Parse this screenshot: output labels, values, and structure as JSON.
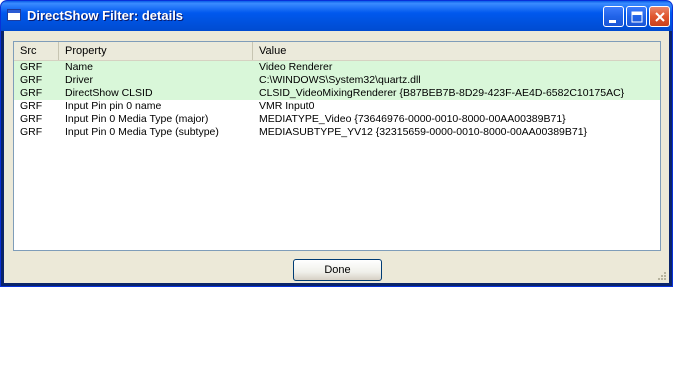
{
  "window": {
    "title": "DirectShow Filter: details"
  },
  "titlebar_buttons": {
    "minimize_icon": "minimize-icon",
    "maximize_icon": "maximize-icon",
    "close_icon": "close-icon"
  },
  "list": {
    "columns": [
      "Src",
      "Property",
      "Value"
    ],
    "rows": [
      {
        "src": "GRF",
        "property": "Name",
        "value": "Video Renderer",
        "highlight": true
      },
      {
        "src": "GRF",
        "property": "Driver",
        "value": "C:\\WINDOWS\\System32\\quartz.dll",
        "highlight": true
      },
      {
        "src": "GRF",
        "property": "DirectShow CLSID",
        "value": "CLSID_VideoMixingRenderer {B87BEB7B-8D29-423F-AE4D-6582C10175AC}",
        "highlight": true
      },
      {
        "src": "GRF",
        "property": "Input Pin pin 0 name",
        "value": "VMR Input0",
        "highlight": false
      },
      {
        "src": "GRF",
        "property": "Input Pin 0 Media Type (major)",
        "value": "MEDIATYPE_Video {73646976-0000-0010-8000-00AA00389B71}",
        "highlight": false
      },
      {
        "src": "GRF",
        "property": "Input Pin 0 Media Type (subtype)",
        "value": "MEDIASUBTYPE_YV12 {32315659-0000-0010-8000-00AA00389B71}",
        "highlight": false
      }
    ]
  },
  "buttons": {
    "done": "Done"
  },
  "colors": {
    "highlight_row": "#d9f7d9",
    "titlebar": "#0054e3",
    "dialog_bg": "#ece9d8"
  }
}
